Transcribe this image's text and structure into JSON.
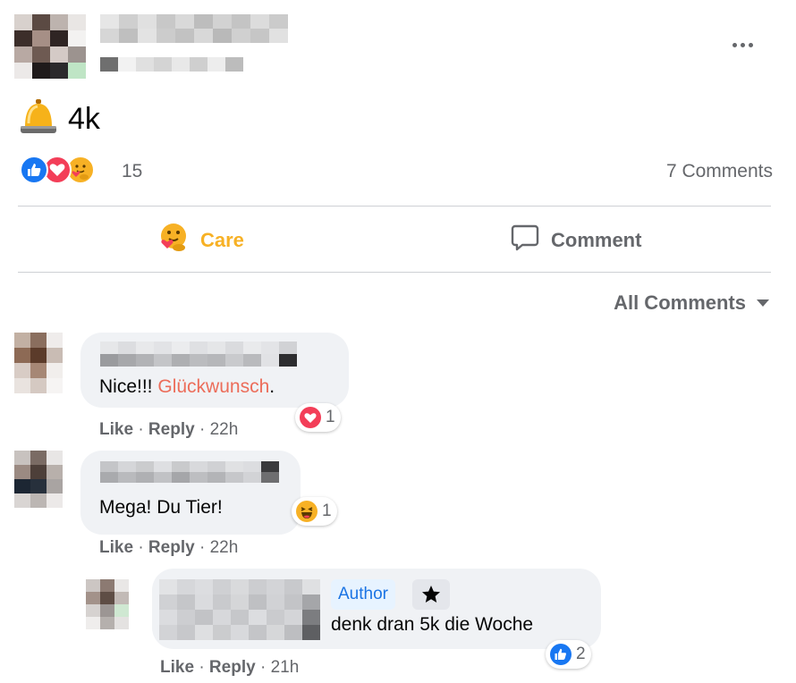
{
  "post": {
    "text": "4k",
    "bell_icon": "bell-icon",
    "reaction_count": "15",
    "comments_count": "7 Comments",
    "reactions": [
      "like",
      "love",
      "care"
    ]
  },
  "actions": {
    "care_label": "Care",
    "comment_label": "Comment"
  },
  "sort": {
    "label": "All Comments"
  },
  "comments": [
    {
      "text_prefix": "Nice!!! ",
      "mention": "Glückwunsch",
      "text_suffix": ".",
      "like_label": "Like",
      "reply_label": "Reply",
      "sep": "·",
      "time": "22h",
      "reaction": "love",
      "reaction_count": "1"
    },
    {
      "text": "Mega! Du Tier!",
      "like_label": "Like",
      "reply_label": "Reply",
      "sep": "·",
      "time": "22h",
      "reaction": "haha",
      "reaction_count": "1"
    },
    {
      "badge": "Author",
      "text": "denk dran 5k die Woche",
      "like_label": "Like",
      "reply_label": "Reply",
      "sep": "·",
      "time": "21h",
      "reaction": "like",
      "reaction_count": "2"
    }
  ],
  "colors": {
    "care": "#f7b125",
    "like": "#1877f2",
    "love": "#f33e58",
    "mention": "#ec6d5a",
    "author_badge_bg": "#e7f3ff",
    "author_badge_text": "#1b74e4",
    "bubble": "#f0f2f5",
    "muted": "#65676b"
  }
}
